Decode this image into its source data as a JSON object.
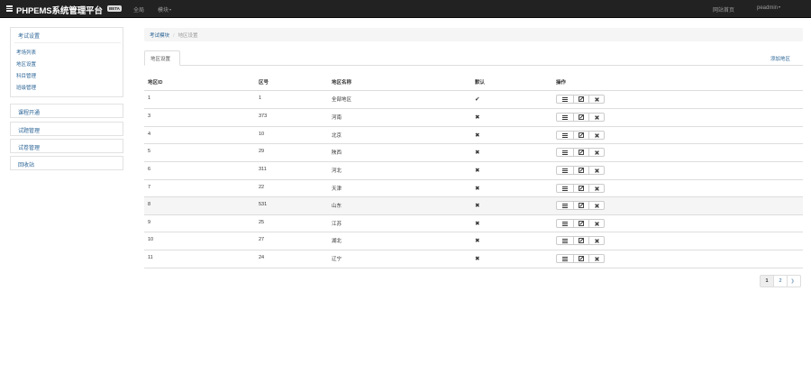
{
  "navbar": {
    "brand": "PHPEMS系统管理平台",
    "badge": "BETA",
    "links": [
      "全局",
      "模块"
    ],
    "right_links": [
      "网站首页",
      "peadmin"
    ]
  },
  "sidebar": {
    "section1": {
      "heading": "考试设置",
      "items": [
        "考场列表",
        "地区设置",
        "科目管理",
        "班级管理"
      ]
    },
    "boxes": [
      "课程开通",
      "试题管理",
      "试卷管理",
      "回收站"
    ]
  },
  "breadcrumb": {
    "items": [
      "考试模块",
      "地区设置"
    ]
  },
  "tabs": {
    "active": "地区设置",
    "add_link": "添加地区"
  },
  "table": {
    "headers": [
      "地区ID",
      "区号",
      "地区名称",
      "默认",
      "操作"
    ],
    "rows": [
      {
        "id": "1",
        "code": "1",
        "name": "全部地区",
        "default": "✔"
      },
      {
        "id": "3",
        "code": "373",
        "name": "河南",
        "default": "✖"
      },
      {
        "id": "4",
        "code": "10",
        "name": "北京",
        "default": "✖"
      },
      {
        "id": "5",
        "code": "29",
        "name": "陕西",
        "default": "✖"
      },
      {
        "id": "6",
        "code": "311",
        "name": "河北",
        "default": "✖"
      },
      {
        "id": "7",
        "code": "22",
        "name": "天津",
        "default": "✖"
      },
      {
        "id": "8",
        "code": "531",
        "name": "山东",
        "default": "✖"
      },
      {
        "id": "9",
        "code": "25",
        "name": "江苏",
        "default": "✖"
      },
      {
        "id": "10",
        "code": "27",
        "name": "湖北",
        "default": "✖"
      },
      {
        "id": "11",
        "code": "24",
        "name": "辽宁",
        "default": "✖"
      }
    ],
    "row_actions": [
      "list-icon",
      "edit-icon",
      "delete-icon"
    ]
  },
  "pagination": {
    "pages": [
      "1",
      "2",
      "》"
    ],
    "current": "1"
  },
  "colors": {
    "navbar": "#222222",
    "link": "#2a6496",
    "highlight_row": "#f5f5f5"
  }
}
